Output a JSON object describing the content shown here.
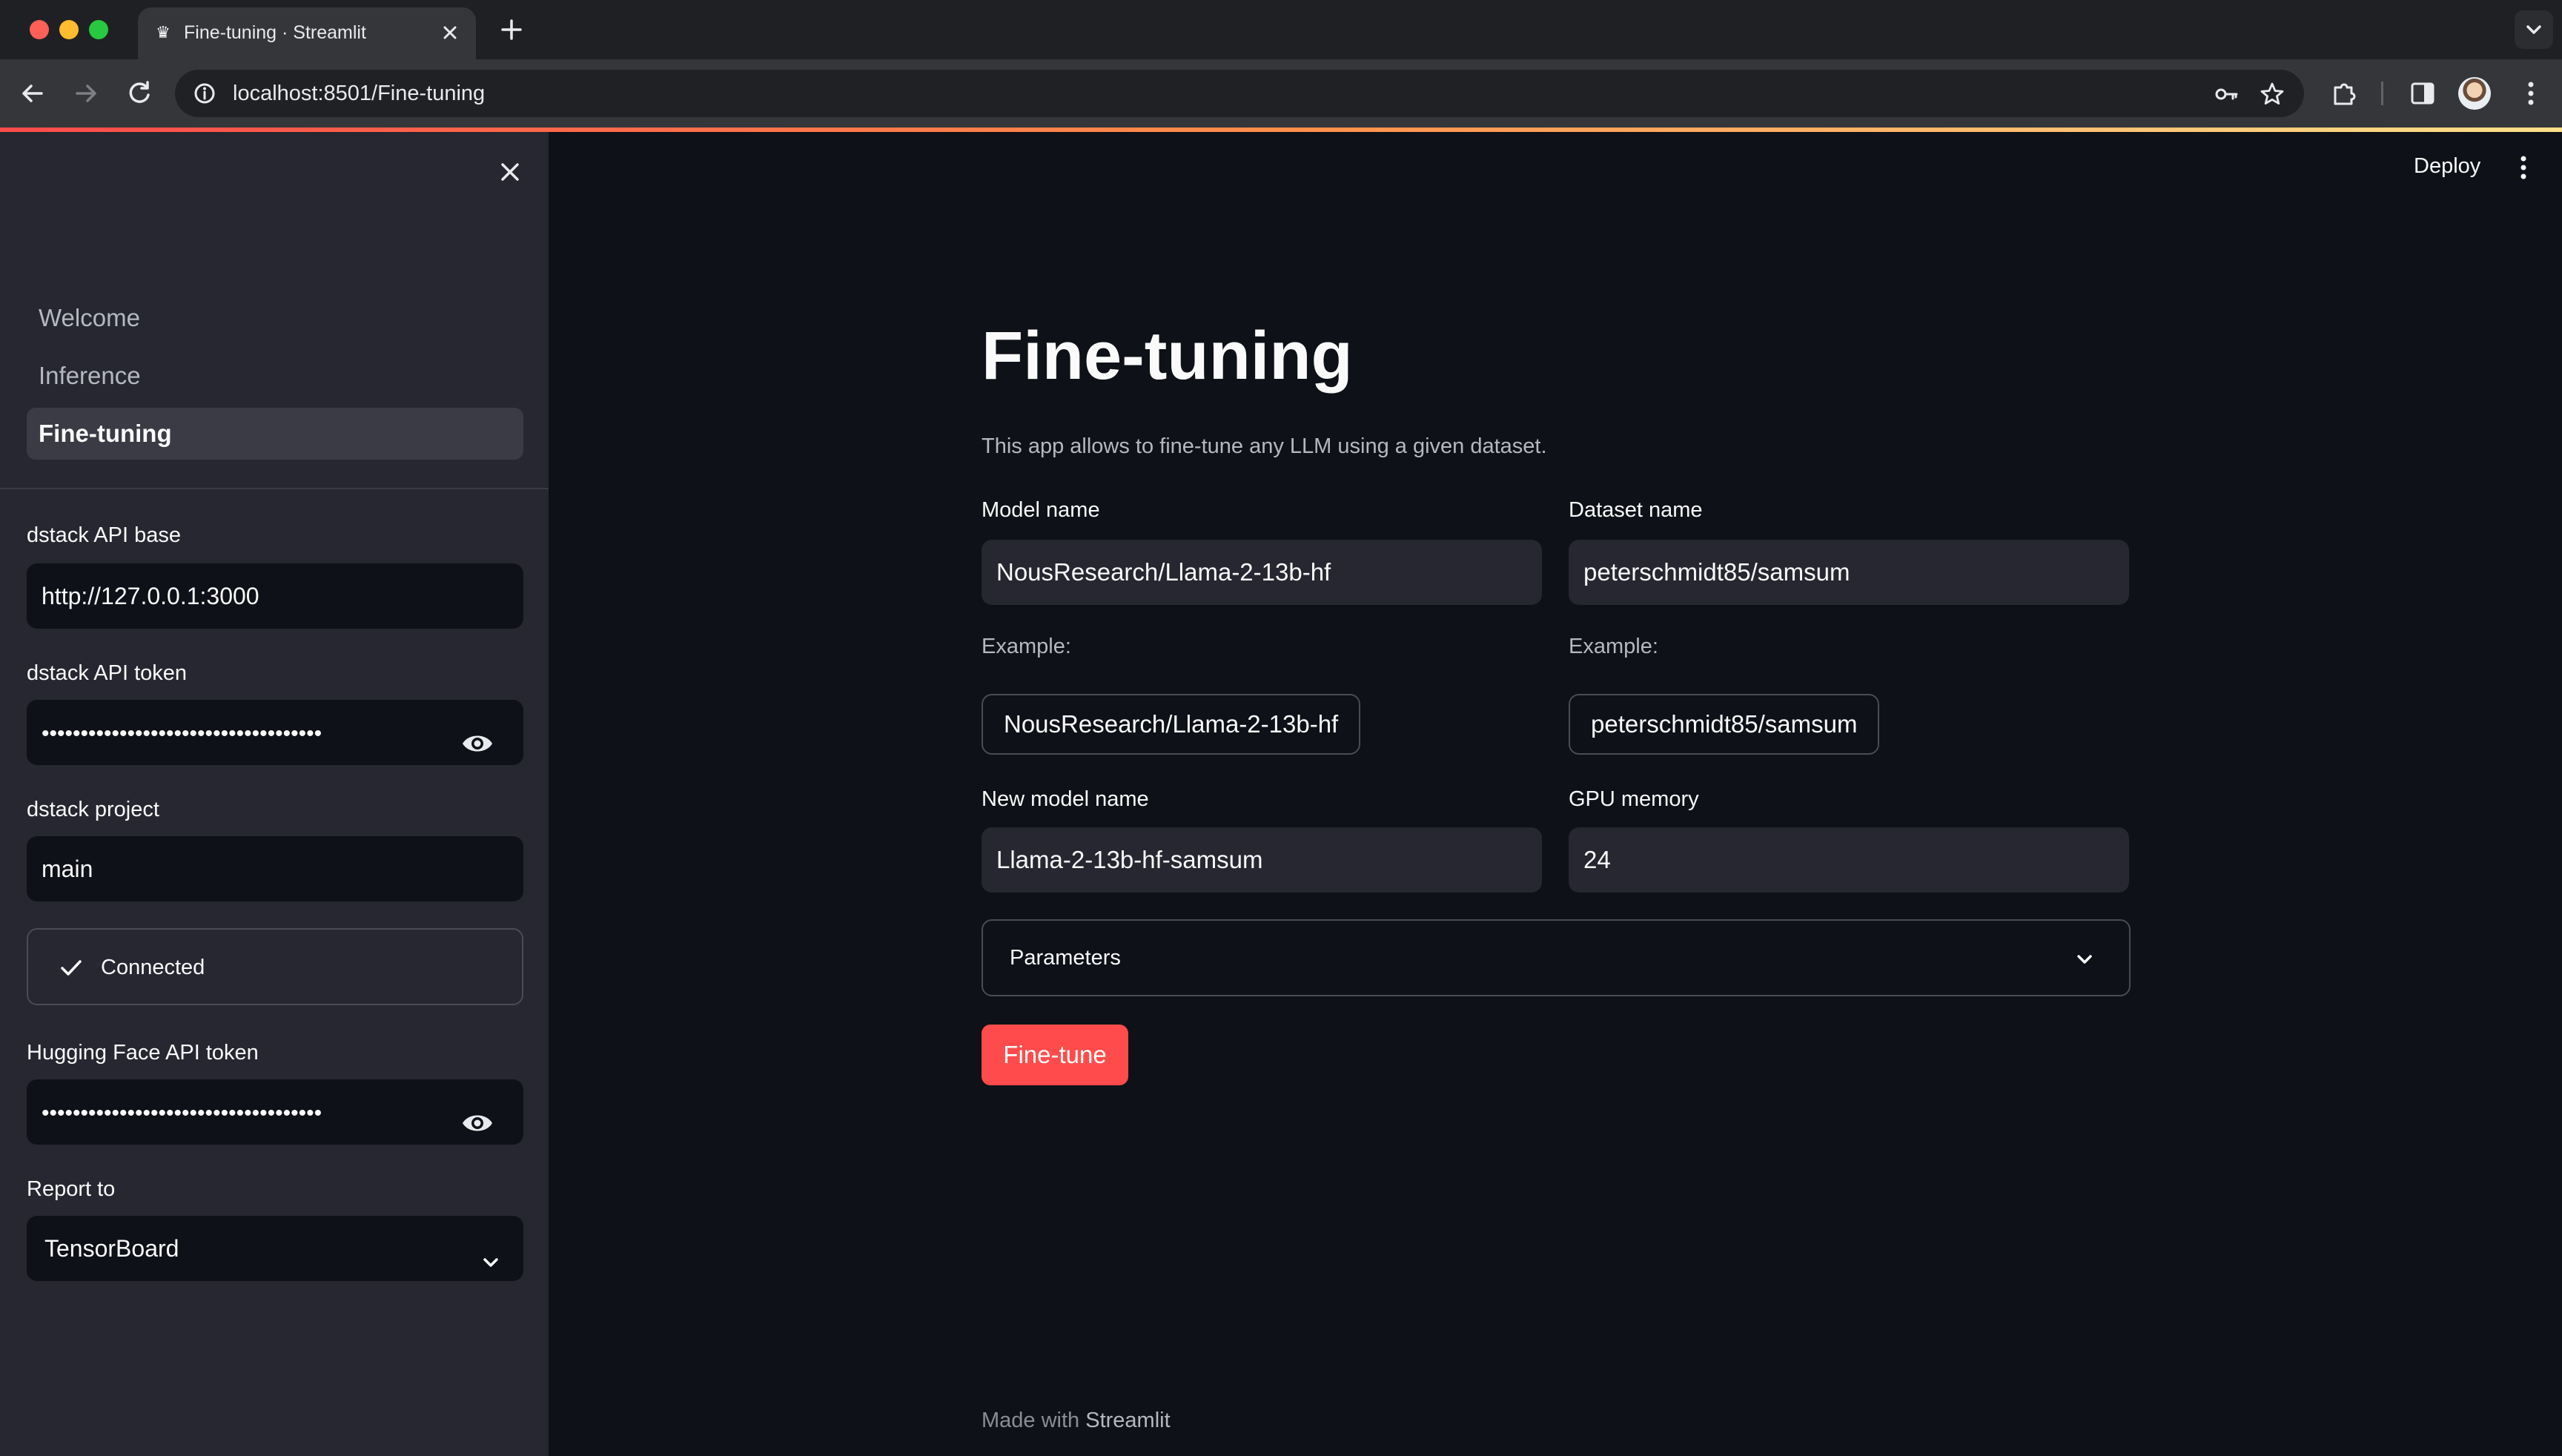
{
  "browser": {
    "tab_title": "Fine-tuning · Streamlit",
    "url": "localhost:8501/Fine-tuning"
  },
  "sidebar": {
    "nav": [
      {
        "label": "Welcome",
        "active": false
      },
      {
        "label": "Inference",
        "active": false
      },
      {
        "label": "Fine-tuning",
        "active": true
      }
    ],
    "api_base": {
      "label": "dstack API base",
      "value": "http://127.0.0.1:3000"
    },
    "api_token": {
      "label": "dstack API token",
      "value": "••••••••••••••••••••••••••••••••••••"
    },
    "project": {
      "label": "dstack project",
      "value": "main"
    },
    "status": {
      "text": "Connected"
    },
    "hf_token": {
      "label": "Hugging Face API token",
      "value": "••••••••••••••••••••••••••••••••••••"
    },
    "report_to": {
      "label": "Report to",
      "value": "TensorBoard"
    }
  },
  "header": {
    "deploy_label": "Deploy"
  },
  "main": {
    "title": "Fine-tuning",
    "caption": "This app allows to fine-tune any LLM using a given dataset.",
    "model_name": {
      "label": "Model name",
      "value": "NousResearch/Llama-2-13b-hf",
      "example_label": "Example:",
      "example_value": "NousResearch/Llama-2-13b-hf"
    },
    "dataset_name": {
      "label": "Dataset name",
      "value": "peterschmidt85/samsum",
      "example_label": "Example:",
      "example_value": "peterschmidt85/samsum"
    },
    "new_model_name": {
      "label": "New model name",
      "value": "Llama-2-13b-hf-samsum"
    },
    "gpu_memory": {
      "label": "GPU memory",
      "value": "24"
    },
    "parameters_label": "Parameters",
    "fine_tune_button": "Fine-tune",
    "footer_prefix": "Made with",
    "footer_brand": "Streamlit"
  },
  "colors": {
    "primary": "#ff4b4b",
    "sidebar_bg": "#262730",
    "main_bg": "#0e1117"
  }
}
